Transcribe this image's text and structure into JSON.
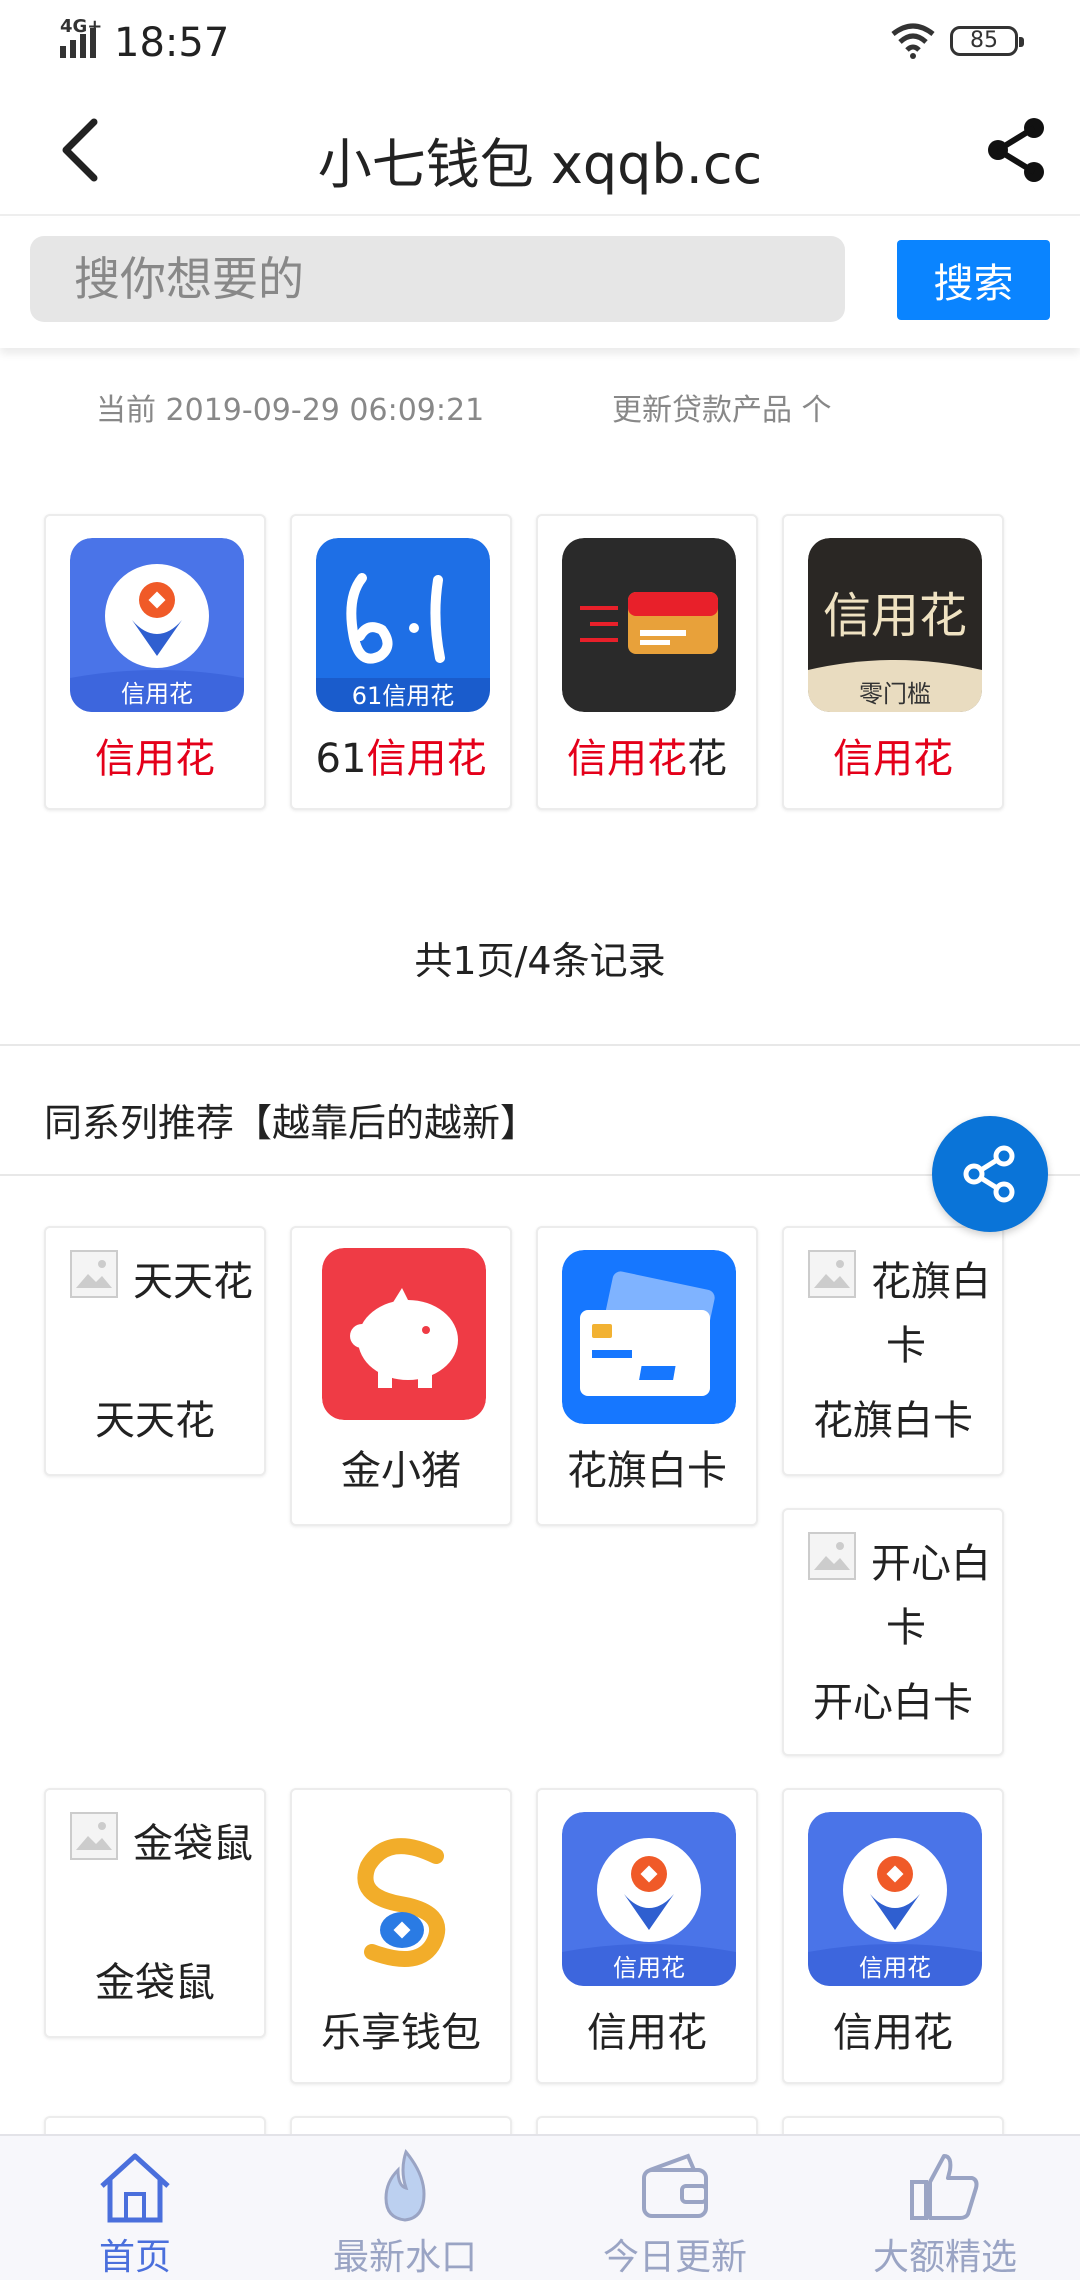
{
  "status_bar": {
    "network": "4G+",
    "time": "18:57",
    "battery": "85"
  },
  "header": {
    "title": "小七钱包 xqqb.cc"
  },
  "search": {
    "placeholder": "搜你想要的",
    "button_label": "搜索"
  },
  "info": {
    "current": "当前 2019-09-29 06:09:21",
    "update_text": "更新贷款产品 个"
  },
  "products": [
    {
      "name_prefix": "",
      "name_red": "信用花",
      "name_suffix": "",
      "icon": "xinyonghua-flower-icon",
      "icon_caption": "信用花"
    },
    {
      "name_prefix": "61",
      "name_red": "信用花",
      "name_suffix": "",
      "icon": "61-xinyonghua-icon",
      "icon_caption": "61信用花"
    },
    {
      "name_prefix": "",
      "name_red": "信用花",
      "name_suffix": "花",
      "icon": "credit-card-icon",
      "icon_caption": ""
    },
    {
      "name_prefix": "",
      "name_red": "信用花",
      "name_suffix": "",
      "icon": "xinyonghua-text-icon",
      "icon_caption": "零门槛",
      "icon_text": "信用花"
    }
  ],
  "pager": "共1页/4条记录",
  "section_title": "同系列推荐【越靠后的越新】",
  "recommend": [
    {
      "alt": "天天花",
      "name": "天天花",
      "icon": "broken-image-icon"
    },
    {
      "alt": "",
      "name": "金小猪",
      "icon": "piggy-bank-icon"
    },
    {
      "alt": "",
      "name": "花旗白卡",
      "icon": "cards-icon"
    },
    {
      "alt": "花旗白卡",
      "name": "花旗白卡",
      "icon": "broken-image-icon"
    },
    {
      "alt": "开心白卡",
      "name": "开心白卡",
      "icon": "broken-image-icon"
    },
    {
      "alt": "金袋鼠",
      "name": "金袋鼠",
      "icon": "broken-image-icon"
    },
    {
      "alt": "",
      "name": "乐享钱包",
      "icon": "swirl-logo-icon"
    },
    {
      "alt": "",
      "name": "信用花",
      "icon": "xinyonghua-flower-icon",
      "icon_caption": "信用花"
    },
    {
      "alt": "",
      "name": "信用花",
      "icon": "xinyonghua-flower-icon",
      "icon_caption": "信用花"
    }
  ],
  "nav": [
    {
      "label": "首页",
      "icon": "home-icon",
      "active": true
    },
    {
      "label": "最新水口",
      "icon": "flame-icon",
      "active": false
    },
    {
      "label": "今日更新",
      "icon": "wallet-icon",
      "active": false
    },
    {
      "label": "大额精选",
      "icon": "thumbs-up-icon",
      "active": false
    }
  ],
  "colors": {
    "accent": "#0a84ff",
    "highlight_red": "#e4001a",
    "nav_active": "#4a6fdc",
    "nav_inactive": "#9aa4c4"
  }
}
